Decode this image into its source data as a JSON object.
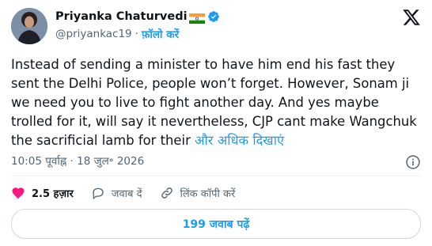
{
  "author": {
    "name": "Priyanka Chaturvedi",
    "handle": "@priyankac19",
    "separator": "·",
    "follow_label": "फ़ॉलो करें"
  },
  "tweet": {
    "text": "Instead of sending a minister to have him end his fast they sent the Delhi Police, people won’t forget. However, Sonam ji we need you to live to fight another day. And yes maybe trolled for it, will say it nevertheless, CJP cant make Wangchuk the sacrificial lamb for their ",
    "show_more": "और अधिक दिखाएं",
    "time": "10:05 पूर्वाह्न · 18 जुल॰ 2026"
  },
  "actions": {
    "likes": "2.5 हज़ार",
    "reply_label": "जवाब दें",
    "copy_link_label": "लिंक कॉपी करें"
  },
  "replies_button": "199 जवाब पढ़ें",
  "icons": {
    "verified": "verified-badge-icon",
    "flag": "india-flag-icon",
    "logo": "x-logo-icon",
    "info": "info-icon",
    "like": "heart-icon",
    "reply": "reply-bubble-icon",
    "link": "link-icon"
  },
  "colors": {
    "accent": "#1d9bf0",
    "like": "#f91880",
    "text": "#0f1419",
    "muted": "#536471"
  }
}
